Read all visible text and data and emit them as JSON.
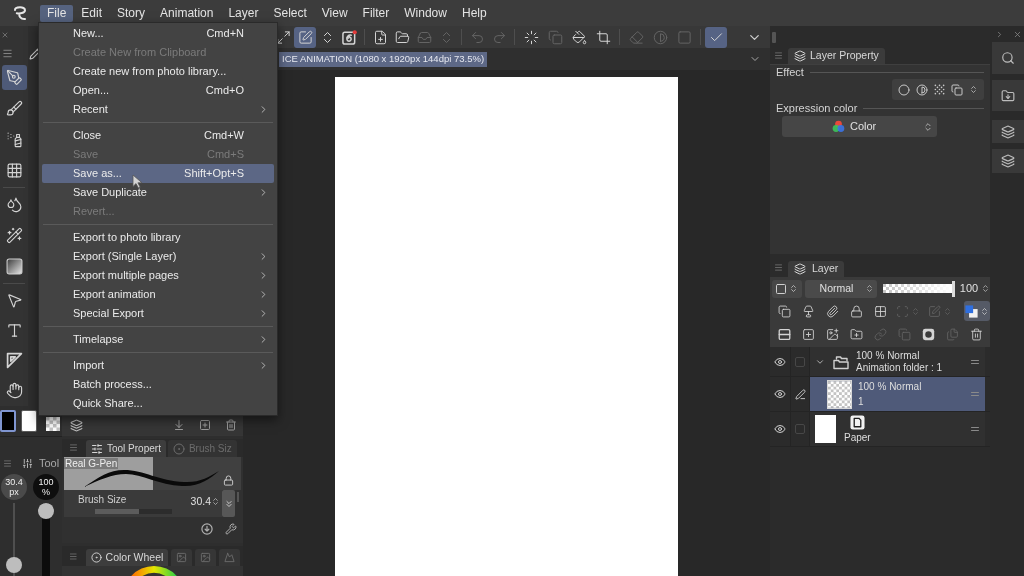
{
  "menubar": {
    "items": [
      {
        "label": "File",
        "selected": true
      },
      {
        "label": "Edit",
        "selected": false
      },
      {
        "label": "Story",
        "selected": false
      },
      {
        "label": "Animation",
        "selected": false
      },
      {
        "label": "Layer",
        "selected": false
      },
      {
        "label": "Select",
        "selected": false
      },
      {
        "label": "View",
        "selected": false
      },
      {
        "label": "Filter",
        "selected": false
      },
      {
        "label": "Window",
        "selected": false
      },
      {
        "label": "Help",
        "selected": false
      }
    ]
  },
  "file_menu": {
    "groups": [
      {
        "items": [
          {
            "label": "New...",
            "shortcut": "Cmd+N",
            "disabled": false,
            "submenu": false,
            "selected": false
          },
          {
            "label": "Create New from Clipboard",
            "disabled": true,
            "submenu": false,
            "selected": false
          },
          {
            "label": "Create new from photo library...",
            "disabled": false,
            "submenu": false,
            "selected": false
          },
          {
            "label": "Open...",
            "shortcut": "Cmd+O",
            "disabled": false,
            "submenu": false,
            "selected": false
          },
          {
            "label": "Recent",
            "disabled": false,
            "submenu": true,
            "selected": false
          }
        ]
      },
      {
        "items": [
          {
            "label": "Close",
            "shortcut": "Cmd+W",
            "disabled": false,
            "submenu": false,
            "selected": false
          },
          {
            "label": "Save",
            "shortcut": "Cmd+S",
            "disabled": true,
            "submenu": false,
            "selected": false
          },
          {
            "label": "Save as...",
            "shortcut": "Shift+Opt+S",
            "disabled": false,
            "submenu": false,
            "selected": true
          },
          {
            "label": "Save Duplicate",
            "disabled": false,
            "submenu": true,
            "selected": false
          },
          {
            "label": "Revert...",
            "disabled": true,
            "submenu": false,
            "selected": false
          }
        ]
      },
      {
        "items": [
          {
            "label": "Export to photo library",
            "disabled": false,
            "submenu": false,
            "selected": false
          },
          {
            "label": "Export (Single Layer)",
            "disabled": false,
            "submenu": true,
            "selected": false
          },
          {
            "label": "Export multiple pages",
            "disabled": false,
            "submenu": true,
            "selected": false
          },
          {
            "label": "Export animation",
            "disabled": false,
            "submenu": true,
            "selected": false
          },
          {
            "label": "Special Export",
            "disabled": false,
            "submenu": true,
            "selected": false
          }
        ]
      },
      {
        "items": [
          {
            "label": "Timelapse",
            "disabled": false,
            "submenu": true,
            "selected": false
          }
        ]
      },
      {
        "items": [
          {
            "label": "Import",
            "disabled": false,
            "submenu": true,
            "selected": false
          },
          {
            "label": "Batch process...",
            "disabled": false,
            "submenu": false,
            "selected": false
          },
          {
            "label": "Quick Share...",
            "disabled": false,
            "submenu": false,
            "selected": false
          }
        ]
      }
    ]
  },
  "toolbar": {
    "groups": [
      {
        "buttons": [
          {
            "selected": false,
            "disabled": false
          },
          {
            "selected": true,
            "disabled": false
          },
          {
            "selected": false,
            "disabled": false
          },
          {
            "selected": false,
            "disabled": false
          }
        ]
      },
      {
        "buttons": [
          {
            "selected": false,
            "disabled": false
          },
          {
            "selected": false,
            "disabled": false
          },
          {
            "selected": false,
            "disabled": true
          },
          {
            "selected": false,
            "disabled": true
          }
        ]
      },
      {
        "buttons": [
          {
            "selected": false,
            "disabled": true
          },
          {
            "selected": false,
            "disabled": true
          }
        ]
      },
      {
        "buttons": [
          {
            "selected": false,
            "disabled": false
          },
          {
            "selected": false,
            "disabled": true
          },
          {
            "selected": false,
            "disabled": false
          },
          {
            "selected": false,
            "disabled": false
          }
        ]
      },
      {
        "buttons": [
          {
            "selected": false,
            "disabled": true
          },
          {
            "selected": false,
            "disabled": true
          },
          {
            "selected": false,
            "disabled": true
          }
        ]
      },
      {
        "buttons": [
          {
            "selected": true,
            "disabled": false
          }
        ]
      }
    ]
  },
  "canvas": {
    "title": "ICE ANIMATION (1080 x 1920px 144dpi 73.5%)"
  },
  "tools": {
    "groups": [
      {
        "items": [
          {
            "selected": true
          },
          {
            "selected": false
          },
          {
            "selected": false
          },
          {
            "selected": false
          }
        ]
      },
      {
        "items": [
          {
            "selected": false
          },
          {
            "selected": false
          },
          {
            "selected": false
          }
        ]
      },
      {
        "items": [
          {
            "selected": false
          },
          {
            "selected": false
          },
          {
            "selected": false
          },
          {
            "selected": false
          }
        ]
      }
    ]
  },
  "colors": {
    "swatches": [
      {
        "color": "#000000",
        "selected": true
      },
      {
        "color": "#ffffff",
        "selected": false
      }
    ]
  },
  "sub_tool": {
    "tab": "Tool",
    "size": {
      "value": "30.4",
      "unit": "px",
      "level": 0.05
    },
    "opacity": {
      "value": "100",
      "unit": "%",
      "level": 1
    }
  },
  "tool_property": {
    "tabs": [
      {
        "label": "Tool Propert",
        "selected": true
      },
      {
        "label": "Brush Siz",
        "selected": false
      }
    ],
    "brush": "Real G-Pen",
    "params": [
      {
        "label": "Brush Size",
        "value": "30.4",
        "level": 0.57
      }
    ]
  },
  "color_panel": {
    "tabs": [
      {
        "label": "Color Wheel",
        "selected": true
      },
      {
        "selected": false
      },
      {
        "selected": false
      },
      {
        "selected": false
      }
    ]
  },
  "layer_property": {
    "tab": "Layer Property",
    "effect_label": "Effect",
    "expression_label": "Expression color",
    "expression_value": "Color"
  },
  "layer_panel": {
    "tab": "Layer",
    "blend_mode": "Normal",
    "opacity": {
      "value": "100",
      "level": 1
    },
    "property_buttons": [
      {
        "selected": false,
        "disabled": false
      },
      {
        "selected": false,
        "disabled": false
      },
      {
        "selected": false,
        "disabled": false
      },
      {
        "selected": false,
        "disabled": false
      },
      {
        "selected": false,
        "disabled": false
      },
      {
        "selected": false,
        "disabled": true
      },
      {
        "selected": false,
        "disabled": true
      },
      {
        "selected": true,
        "disabled": false
      }
    ],
    "action_buttons": [
      {
        "disabled": false
      },
      {
        "disabled": false
      },
      {
        "disabled": false
      },
      {
        "disabled": false
      },
      {
        "disabled": true
      },
      {
        "disabled": true
      },
      {
        "disabled": false
      },
      {
        "disabled": true
      },
      {
        "disabled": false
      }
    ],
    "layers": [
      {
        "kind": "folder",
        "mode": "100 % Normal",
        "name": "Animation folder : 1",
        "visible": true,
        "checked": false,
        "expanded": true,
        "selected": false,
        "children": [
          {
            "kind": "raster",
            "mode": "100 % Normal",
            "name": "1",
            "visible": true,
            "selected": true
          }
        ]
      },
      {
        "kind": "paper",
        "name": "Paper",
        "visible": true,
        "checked": false,
        "selected": false
      }
    ]
  }
}
